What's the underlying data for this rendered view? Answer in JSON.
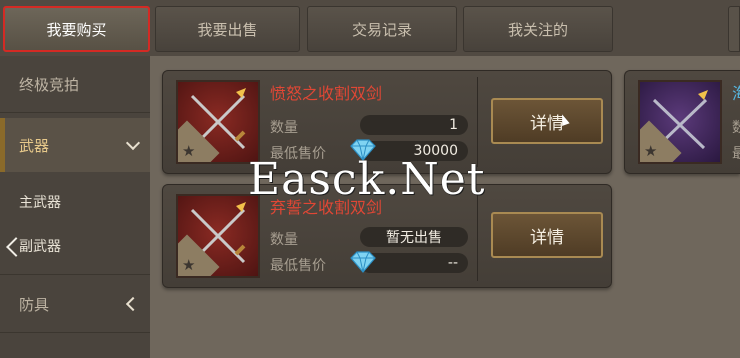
{
  "tabs": [
    {
      "label": "我要购买",
      "active": true
    },
    {
      "label": "我要出售",
      "active": false
    },
    {
      "label": "交易记录",
      "active": false
    },
    {
      "label": "我关注的",
      "active": false
    }
  ],
  "sidebar": {
    "items": [
      {
        "label": "终极竞拍"
      },
      {
        "label": "武器"
      },
      {
        "label": "主武器"
      },
      {
        "label": "副武器"
      },
      {
        "label": "防具"
      }
    ]
  },
  "listings": [
    {
      "name": "愤怒之收割双剑",
      "quantity_label": "数量",
      "quantity": "1",
      "price_label": "最低售价",
      "price": "30000",
      "detail_label": "详情",
      "icon": "crossed-swords-icon"
    },
    {
      "name": "弃誓之收割双剑",
      "quantity_label": "数量",
      "quantity": "暂无出售",
      "price_label": "最低售价",
      "price": "--",
      "detail_label": "详情",
      "icon": "crossed-swords-icon"
    }
  ],
  "partial_listing": {
    "name": "海",
    "quantity_label": "数",
    "price_label": "最"
  },
  "watermark": "Easck.Net",
  "colors": {
    "active_tab_border": "#d42a24",
    "item_name": "#e04735",
    "detail_button": "#6c5537"
  }
}
